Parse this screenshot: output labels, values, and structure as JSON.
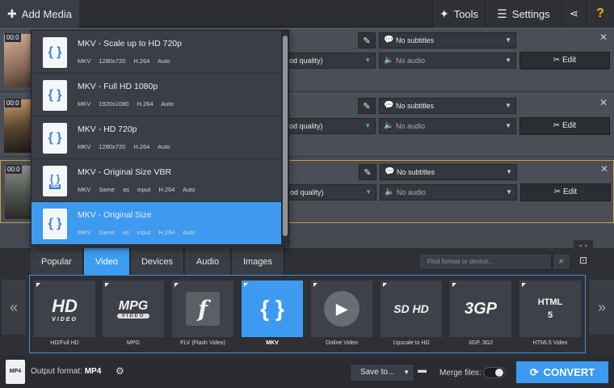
{
  "toolbar": {
    "add_media": "Add Media",
    "tools": "Tools",
    "settings": "Settings",
    "help": "?"
  },
  "files": [
    {
      "time": "00:0",
      "quality": "od quality)",
      "subtitles": "No subtitles",
      "audio": "No audio",
      "edit": "Edit"
    },
    {
      "time": "00:0",
      "quality": "od quality)",
      "subtitles": "No subtitles",
      "audio": "No audio",
      "edit": "Edit"
    },
    {
      "time": "00:0",
      "quality": "od quality)",
      "subtitles": "No subtitles",
      "audio": "No audio",
      "edit": "Edit"
    }
  ],
  "dropdown": {
    "items": [
      {
        "title": "MKV - Scale up to HD 720p",
        "c1": "MKV",
        "c2": "1280x720",
        "c3": "H.264",
        "c4": "Auto"
      },
      {
        "title": "MKV - Full HD 1080p",
        "c1": "MKV",
        "c2": "1920x1080",
        "c3": "H.264",
        "c4": "Auto"
      },
      {
        "title": "MKV - HD 720p",
        "c1": "MKV",
        "c2": "1280x720",
        "c3": "H.264",
        "c4": "Auto"
      },
      {
        "title": "MKV - Original Size VBR",
        "c1": "MKV",
        "c2": "Same as input",
        "c3": "H.264",
        "c4": "Auto",
        "badge": "VBR"
      },
      {
        "title": "MKV - Original Size",
        "c1": "MKV",
        "c2": "Same as input",
        "c3": "H.264",
        "c4": "Auto"
      }
    ]
  },
  "tabs": [
    "Popular",
    "Video",
    "Devices",
    "Audio",
    "Images"
  ],
  "search": {
    "placeholder": "Find format or device..."
  },
  "formats": [
    {
      "label": "HD/Full HD",
      "text": "HD",
      "sub": "VIDEO"
    },
    {
      "label": "MPG",
      "text": "MPG",
      "sub": "VIDEO"
    },
    {
      "label": "FLV (Flash Video)",
      "text": "f"
    },
    {
      "label": "MKV",
      "text": "{ }"
    },
    {
      "label": "Online Video",
      "text": "▶"
    },
    {
      "label": "Upscale to HD",
      "text": "SD HD"
    },
    {
      "label": "3GP, 3G2",
      "text": "3GP"
    },
    {
      "label": "HTML5 Video",
      "text": "HTML 5"
    }
  ],
  "bottom": {
    "output_label": "Output format:",
    "output_value": "MP4",
    "mp4_icon": "MP4",
    "save_to": "Save to...",
    "merge": "Merge files:",
    "convert": "CONVERT"
  },
  "colors": {
    "accent": "#3d9af0",
    "selected_border": "#c9a13a"
  }
}
